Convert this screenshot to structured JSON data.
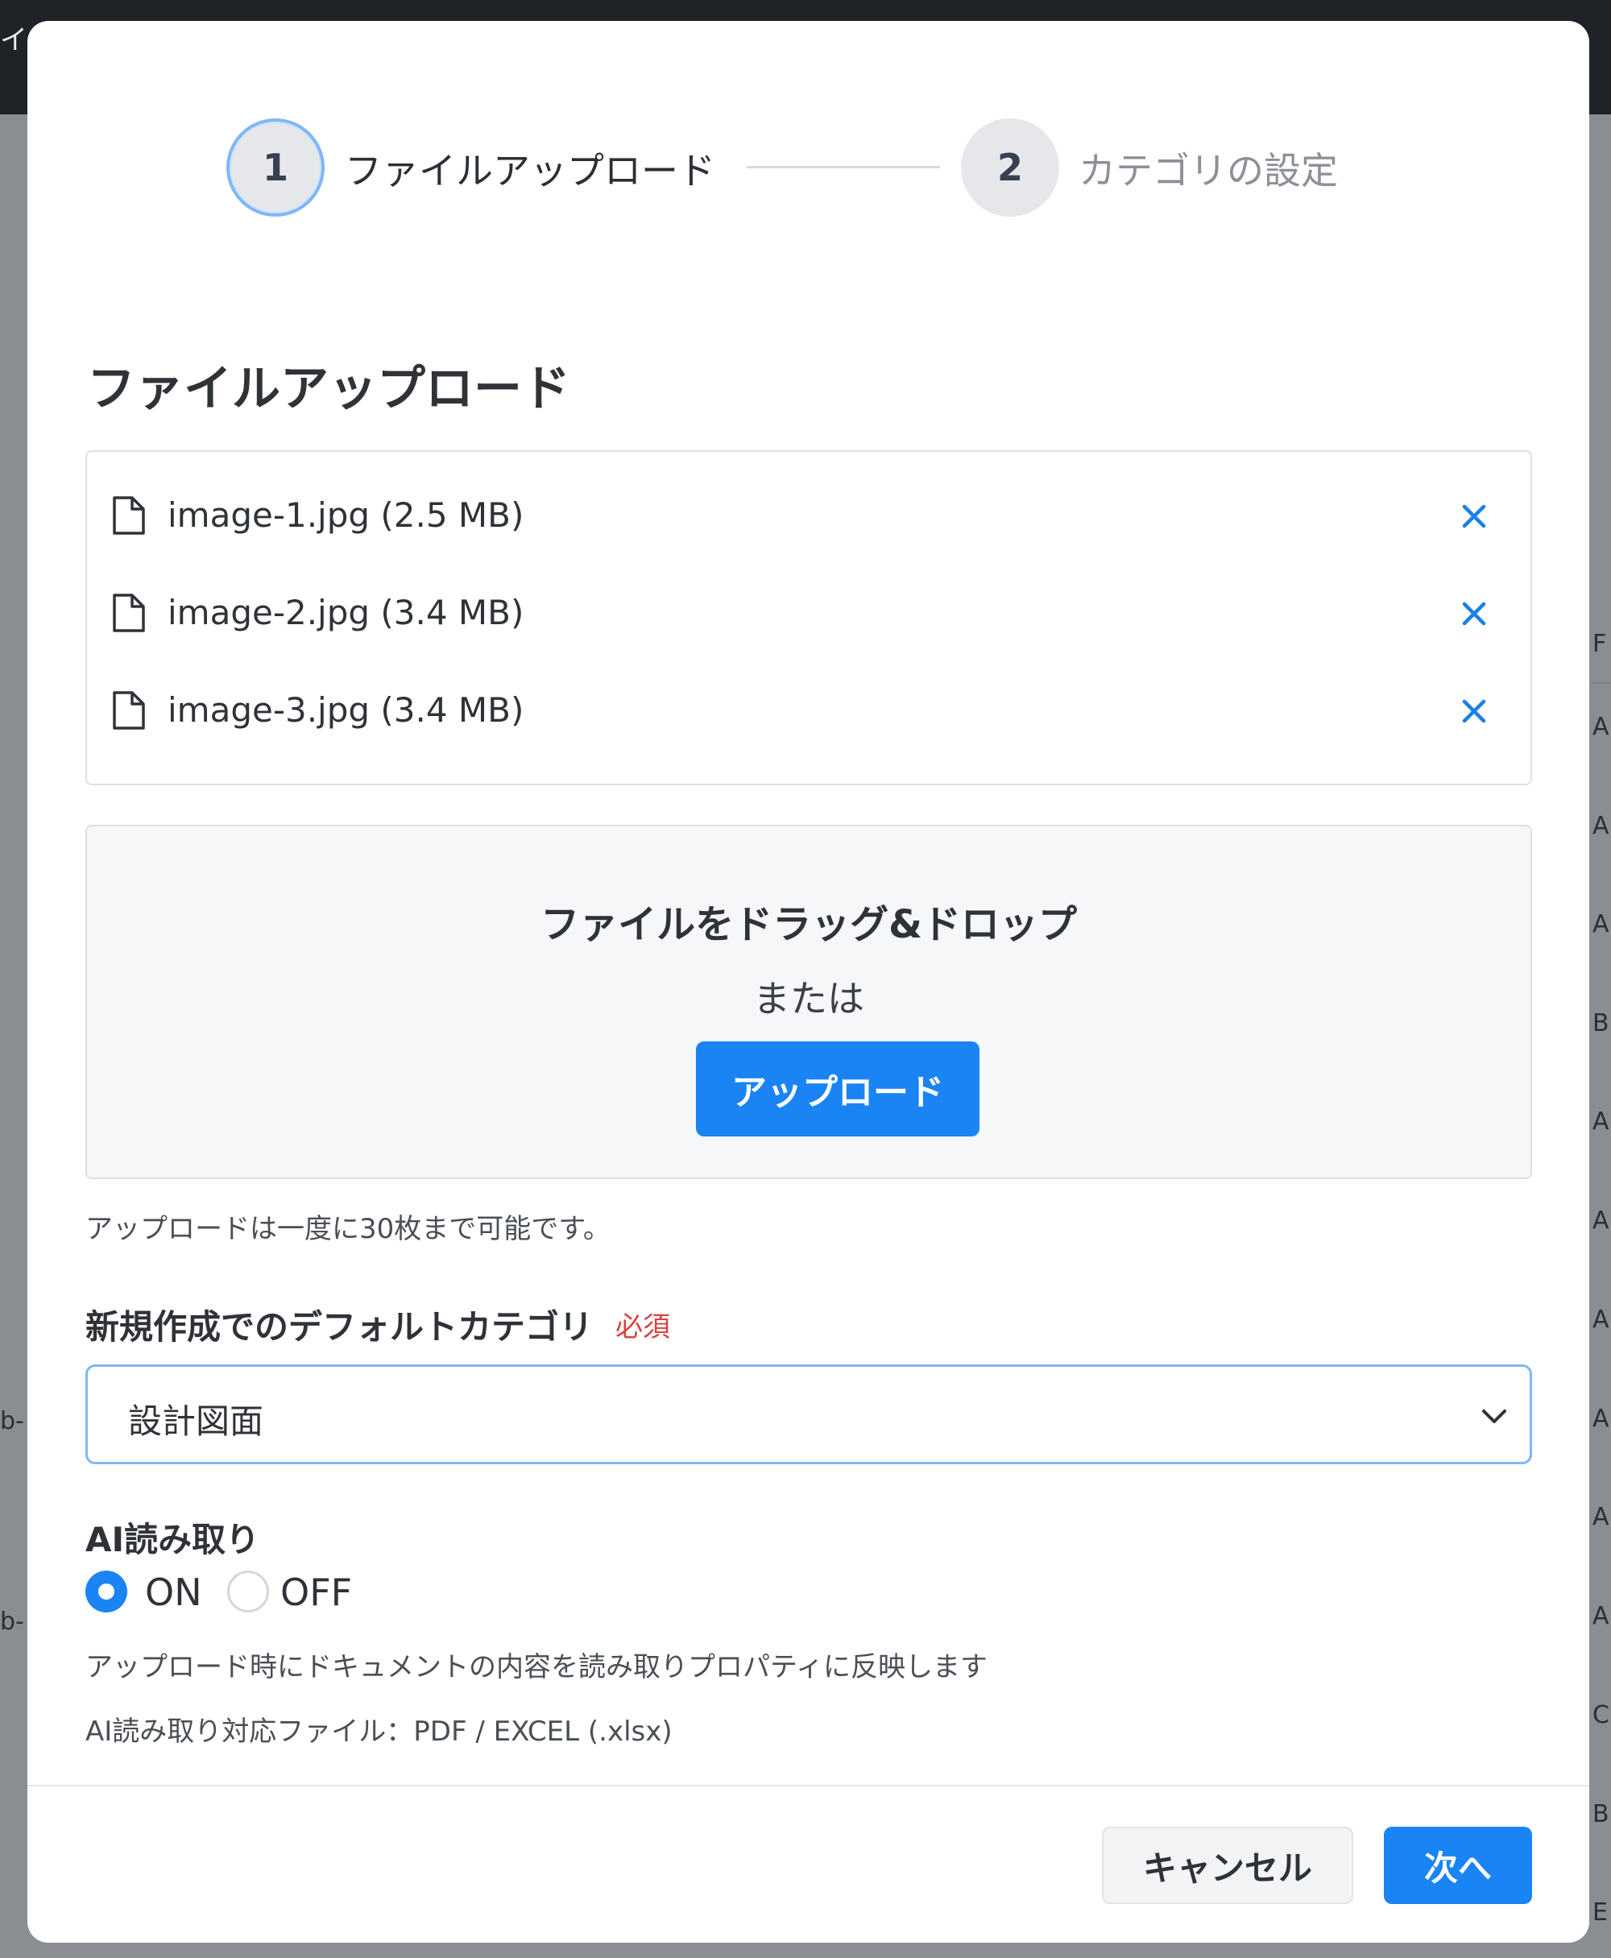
{
  "background": {
    "title_fragment": "イ",
    "right_column": [
      "F",
      "A",
      "A",
      "A",
      "B",
      "A",
      "A",
      "A",
      "A",
      "A",
      "A",
      "C",
      "B",
      "E"
    ],
    "left_column": [
      "b-",
      "b-"
    ]
  },
  "stepper": {
    "steps": [
      {
        "number": "1",
        "label": "ファイルアップロード",
        "state": "active"
      },
      {
        "number": "2",
        "label": "カテゴリの設定",
        "state": "inactive"
      }
    ]
  },
  "section_title": "ファイルアップロード",
  "files": [
    {
      "name": "image-1.jpg (2.5 MB)"
    },
    {
      "name": "image-2.jpg (3.4 MB)"
    },
    {
      "name": "image-3.jpg (3.4 MB)"
    }
  ],
  "dropzone": {
    "title": "ファイルをドラッグ&ドロップ",
    "or": "または",
    "button": "アップロード"
  },
  "upload_hint": "アップロードは一度に30枚まで可能です。",
  "default_category": {
    "label": "新規作成でのデフォルトカテゴリ",
    "required": "必須",
    "value": "設計図面"
  },
  "ai_reading": {
    "label": "AI読み取り",
    "options": [
      {
        "label": "ON",
        "selected": true
      },
      {
        "label": "OFF",
        "selected": false
      }
    ],
    "description": "アップロード時にドキュメントの内容を読み取りプロパティに反映します",
    "supported_files": "AI読み取り対応ファイル：PDF / EXCEL (.xlsx)"
  },
  "footer": {
    "cancel": "キャンセル",
    "next": "次へ"
  },
  "colors": {
    "accent": "#1a84f5",
    "required": "#d94141",
    "focus_border": "#7fb7f5"
  },
  "icons": {
    "file": "file-icon",
    "remove": "close-icon",
    "chevron": "chevron-down-icon"
  }
}
